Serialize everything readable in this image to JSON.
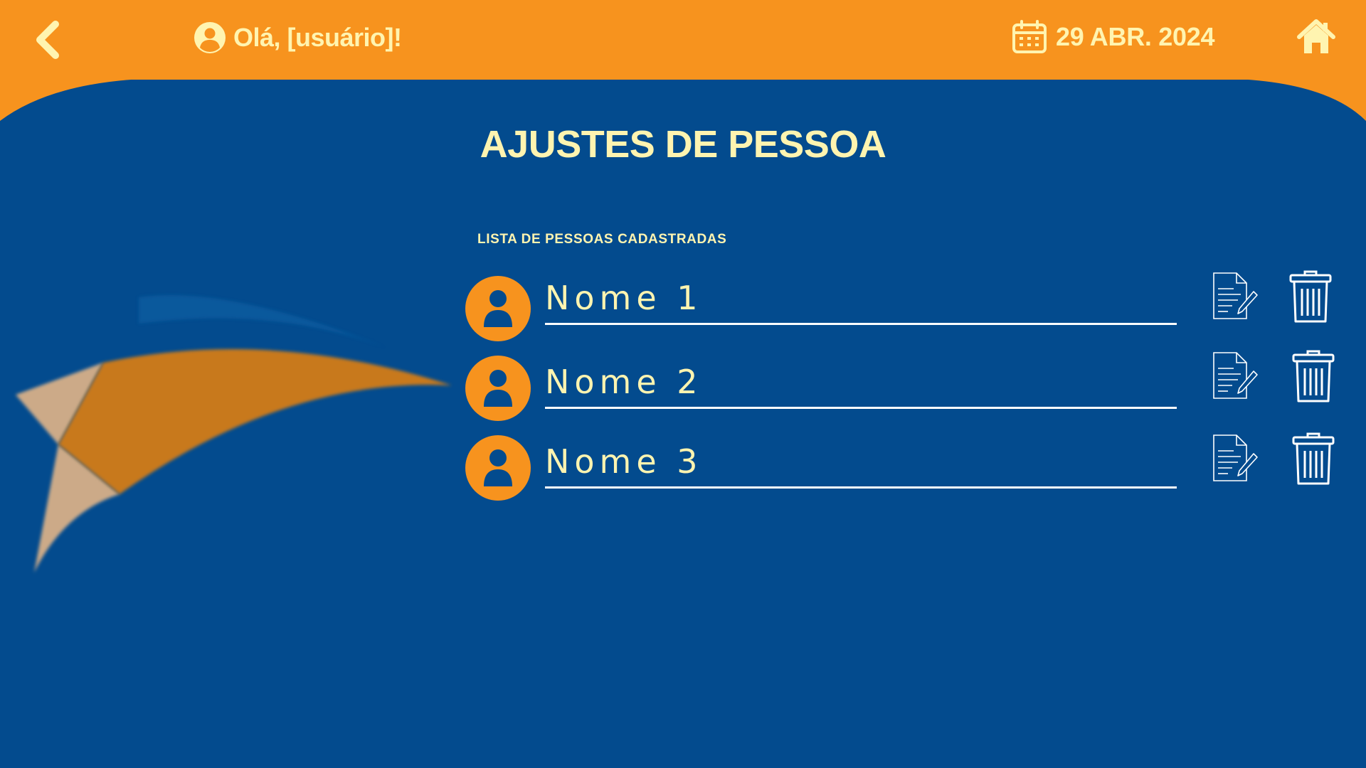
{
  "header": {
    "greeting": "Olá, [usuário]!",
    "date": "29 ABR. 2024",
    "back_icon": "chevron-left-icon",
    "home_icon": "home-icon",
    "user_icon": "user-circle-icon",
    "calendar_icon": "calendar-icon"
  },
  "page": {
    "title": "AJUSTES DE PESSOA",
    "list_heading": "LISTA DE PESSOAS CADASTRADAS"
  },
  "people": [
    {
      "name": "Nome 1"
    },
    {
      "name": "Nome 2"
    },
    {
      "name": "Nome 3"
    }
  ],
  "colors": {
    "header_orange": "#f7931e",
    "background_blue": "#034b8e",
    "text_cream": "#fff4b0",
    "white": "#ffffff"
  }
}
